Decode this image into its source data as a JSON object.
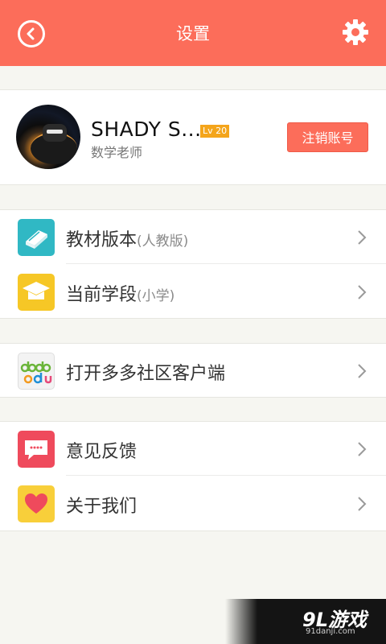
{
  "header": {
    "title": "设置"
  },
  "profile": {
    "name": "SHADY S...",
    "level": "Lv 20",
    "role": "数学老师",
    "logout_label": "注销账号"
  },
  "menu": [
    {
      "label": "教材版本",
      "sub": "(人教版)",
      "icon": "book-icon",
      "color": "#30b8c4"
    },
    {
      "label": "当前学段",
      "sub": "(小学)",
      "icon": "graduation-cap-icon",
      "color": "#f6c726"
    },
    {
      "label": "打开多多社区客户端",
      "sub": "",
      "icon": "dodo-edu-logo",
      "color": "#f3f3f3"
    },
    {
      "label": "意见反馈",
      "sub": "",
      "icon": "feedback-chat-icon",
      "color": "#ef4a5c"
    },
    {
      "label": "关于我们",
      "sub": "",
      "icon": "heart-icon",
      "color": "#f8cf3a"
    }
  ],
  "watermark": {
    "text": "9L游戏",
    "url": "91danji.com"
  },
  "colors": {
    "accent": "#fc6d5a",
    "badge": "#f4a51b",
    "background": "#f6f6f1"
  }
}
